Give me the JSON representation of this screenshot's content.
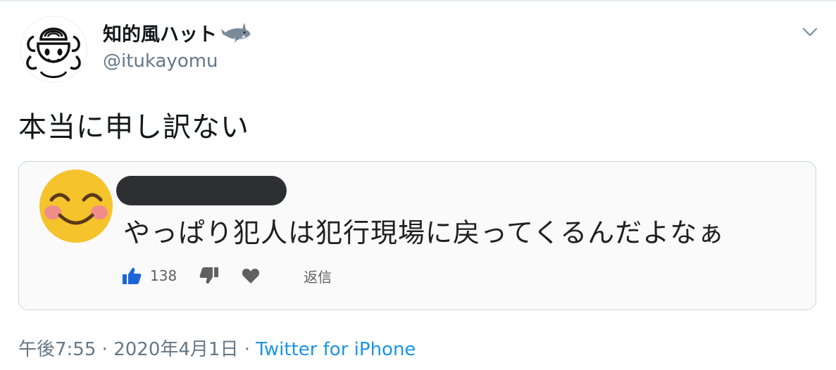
{
  "user": {
    "display_name": "知的風ハット",
    "handle": "@itukayomu",
    "avatar_icon": "cartoon-face-avatar-icon",
    "name_emoji": "shark-icon"
  },
  "tweet": {
    "text": "本当に申し訳ない"
  },
  "embedded": {
    "commenter_icon": "smiling-face-emoji-icon",
    "commenter_name_redacted": true,
    "comment": "やっぱり犯人は犯行現場に戻ってくるんだよなぁ",
    "like_count": "138",
    "reply_label": "返信",
    "like_color": "#1a66d6"
  },
  "meta": {
    "time": "午後7:55",
    "separator": "·",
    "date": "2020年4月1日",
    "source": "Twitter for iPhone",
    "source_color": "#1b95e0"
  }
}
